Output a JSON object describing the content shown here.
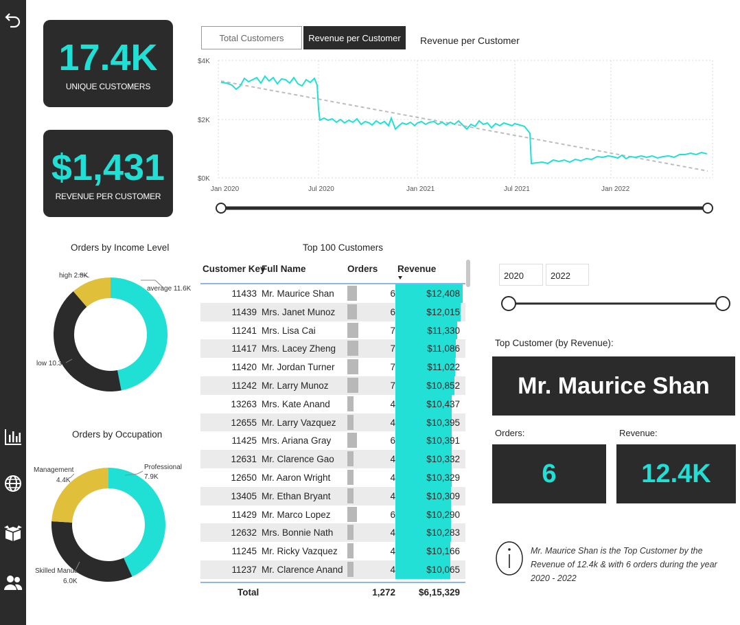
{
  "kpis": {
    "unique_customers": {
      "value": "17.4K",
      "label": "UNIQUE CUSTOMERS"
    },
    "revenue_per_customer": {
      "value": "$1,431",
      "label": "REVENUE PER CUSTOMER"
    }
  },
  "tabs": {
    "total_customers": "Total Customers",
    "revenue_per_customer": "Revenue per Customer"
  },
  "line_chart": {
    "title": "Revenue per Customer",
    "y_ticks": [
      "$4K",
      "$2K",
      "$0K"
    ],
    "x_ticks": [
      "Jan 2020",
      "Jul 2020",
      "Jan 2021",
      "Jul 2021",
      "Jan 2022"
    ],
    "line_color": "#20e0d6",
    "trend_color": "#bdbdbd"
  },
  "donut_income": {
    "title": "Orders by Income Level",
    "slices": [
      {
        "label": "average 11.6K",
        "value": 11.6,
        "color": "#20e0d6"
      },
      {
        "label": "low 10.3K",
        "value": 10.3,
        "color": "#2b2b2b"
      },
      {
        "label": "high 2.8K",
        "value": 2.8,
        "color": "#e0bf3a"
      }
    ]
  },
  "donut_occupation": {
    "title": "Orders by Occupation",
    "slices": [
      {
        "label1": "Professional",
        "label2": "7.9K",
        "value": 7.9,
        "color": "#20e0d6"
      },
      {
        "label1": "Skilled Manual",
        "label2": "6.0K",
        "value": 6.0,
        "color": "#2b2b2b"
      },
      {
        "label1": "Management",
        "label2": "4.4K",
        "value": 4.4,
        "color": "#e0bf3a"
      }
    ]
  },
  "table": {
    "title": "Top 100 Customers",
    "headers": {
      "key": "Customer Key",
      "name": "Full Name",
      "orders": "Orders",
      "revenue": "Revenue"
    },
    "rows": [
      {
        "key": "11433",
        "name": "Mr. Maurice Shan",
        "orders": "6",
        "revenue": "$12,408"
      },
      {
        "key": "11439",
        "name": "Mrs. Janet Munoz",
        "orders": "6",
        "revenue": "$12,015"
      },
      {
        "key": "11241",
        "name": "Mrs. Lisa Cai",
        "orders": "7",
        "revenue": "$11,330"
      },
      {
        "key": "11417",
        "name": "Mrs. Lacey Zheng",
        "orders": "7",
        "revenue": "$11,086"
      },
      {
        "key": "11420",
        "name": "Mr. Jordan Turner",
        "orders": "7",
        "revenue": "$11,022"
      },
      {
        "key": "11242",
        "name": "Mr. Larry Munoz",
        "orders": "7",
        "revenue": "$10,852"
      },
      {
        "key": "13263",
        "name": "Mrs. Kate Anand",
        "orders": "4",
        "revenue": "$10,437"
      },
      {
        "key": "12655",
        "name": "Mr. Larry Vazquez",
        "orders": "4",
        "revenue": "$10,395"
      },
      {
        "key": "11425",
        "name": "Mrs. Ariana Gray",
        "orders": "6",
        "revenue": "$10,391"
      },
      {
        "key": "12631",
        "name": "Mr. Clarence Gao",
        "orders": "4",
        "revenue": "$10,332"
      },
      {
        "key": "12650",
        "name": "Mr. Aaron Wright",
        "orders": "4",
        "revenue": "$10,329"
      },
      {
        "key": "13405",
        "name": "Mr. Ethan Bryant",
        "orders": "4",
        "revenue": "$10,309"
      },
      {
        "key": "11429",
        "name": "Mr. Marco Lopez",
        "orders": "6",
        "revenue": "$10,290"
      },
      {
        "key": "12632",
        "name": "Mrs. Bonnie Nath",
        "orders": "4",
        "revenue": "$10,283"
      },
      {
        "key": "11245",
        "name": "Mr. Ricky Vazquez",
        "orders": "4",
        "revenue": "$10,166"
      },
      {
        "key": "11237",
        "name": "Mr. Clarence Anand",
        "orders": "4",
        "revenue": "$10,065"
      }
    ],
    "total": {
      "label": "Total",
      "orders": "1,272",
      "revenue": "$6,15,329"
    }
  },
  "year_filter": {
    "from": "2020",
    "to": "2022"
  },
  "top_customer": {
    "title": "Top Customer (by Revenue):",
    "name": "Mr. Maurice Shan",
    "orders_label": "Orders:",
    "orders_value": "6",
    "revenue_label": "Revenue:",
    "revenue_value": "12.4K",
    "info_text": "Mr. Maurice Shan is the Top Customer by the Revenue of 12.4k & with 6 orders during the year 2020 - 2022"
  },
  "sidebar_icons": [
    "back-arrow-icon",
    "bar-chart-icon",
    "globe-icon",
    "box-icon",
    "users-icon"
  ]
}
